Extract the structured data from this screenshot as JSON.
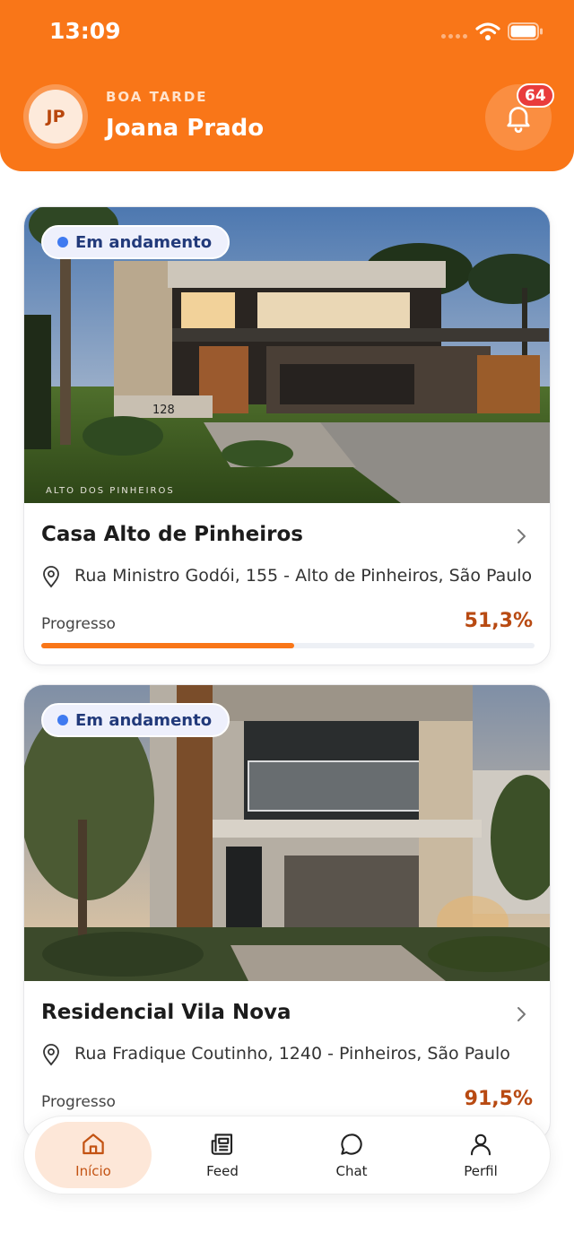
{
  "status_bar": {
    "time": "13:09"
  },
  "header": {
    "avatar_initials": "JP",
    "greeting": "BOA TARDE",
    "user_name": "Joana Prado",
    "notification_count": "64"
  },
  "projects": [
    {
      "status": "Em andamento",
      "title": "Casa Alto de Pinheiros",
      "address": "Rua Ministro Godói, 155 - Alto de Pinheiros, São Paulo",
      "progress_label": "Progresso",
      "progress_text": "51,3%",
      "progress": 51.3,
      "image_house_number": "128",
      "image_caption": "ALTO DOS PINHEIROS"
    },
    {
      "status": "Em andamento",
      "title": "Residencial Vila Nova",
      "address": "Rua Fradique Coutinho, 1240 - Pinheiros, São Paulo",
      "progress_label": "Progresso",
      "progress_text": "91,5%",
      "progress": 91.5
    }
  ],
  "tabbar": {
    "tabs": [
      {
        "label": "Início",
        "icon": "home-icon",
        "active": true
      },
      {
        "label": "Feed",
        "icon": "newspaper-icon",
        "active": false
      },
      {
        "label": "Chat",
        "icon": "chat-bubble-icon",
        "active": false
      },
      {
        "label": "Perfil",
        "icon": "person-icon",
        "active": false
      }
    ]
  },
  "colors": {
    "brand_orange": "#f97618",
    "progress_value": "#b84a12",
    "status_dot": "#3f7af0",
    "badge_red": "#e93c3c"
  }
}
